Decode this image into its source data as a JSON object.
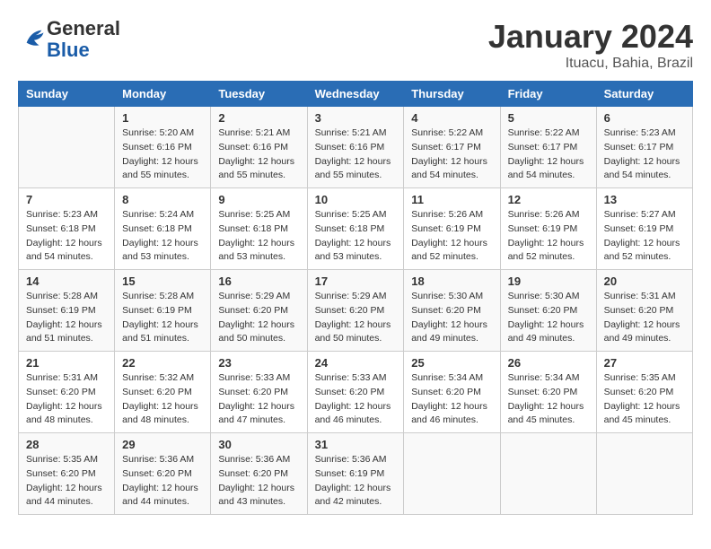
{
  "logo": {
    "general": "General",
    "blue": "Blue"
  },
  "header": {
    "month": "January 2024",
    "location": "Ituacu, Bahia, Brazil"
  },
  "columns": [
    "Sunday",
    "Monday",
    "Tuesday",
    "Wednesday",
    "Thursday",
    "Friday",
    "Saturday"
  ],
  "weeks": [
    [
      {
        "day": "",
        "sunrise": "",
        "sunset": "",
        "daylight": ""
      },
      {
        "day": "1",
        "sunrise": "Sunrise: 5:20 AM",
        "sunset": "Sunset: 6:16 PM",
        "daylight": "Daylight: 12 hours and 55 minutes."
      },
      {
        "day": "2",
        "sunrise": "Sunrise: 5:21 AM",
        "sunset": "Sunset: 6:16 PM",
        "daylight": "Daylight: 12 hours and 55 minutes."
      },
      {
        "day": "3",
        "sunrise": "Sunrise: 5:21 AM",
        "sunset": "Sunset: 6:16 PM",
        "daylight": "Daylight: 12 hours and 55 minutes."
      },
      {
        "day": "4",
        "sunrise": "Sunrise: 5:22 AM",
        "sunset": "Sunset: 6:17 PM",
        "daylight": "Daylight: 12 hours and 54 minutes."
      },
      {
        "day": "5",
        "sunrise": "Sunrise: 5:22 AM",
        "sunset": "Sunset: 6:17 PM",
        "daylight": "Daylight: 12 hours and 54 minutes."
      },
      {
        "day": "6",
        "sunrise": "Sunrise: 5:23 AM",
        "sunset": "Sunset: 6:17 PM",
        "daylight": "Daylight: 12 hours and 54 minutes."
      }
    ],
    [
      {
        "day": "7",
        "sunrise": "Sunrise: 5:23 AM",
        "sunset": "Sunset: 6:18 PM",
        "daylight": "Daylight: 12 hours and 54 minutes."
      },
      {
        "day": "8",
        "sunrise": "Sunrise: 5:24 AM",
        "sunset": "Sunset: 6:18 PM",
        "daylight": "Daylight: 12 hours and 53 minutes."
      },
      {
        "day": "9",
        "sunrise": "Sunrise: 5:25 AM",
        "sunset": "Sunset: 6:18 PM",
        "daylight": "Daylight: 12 hours and 53 minutes."
      },
      {
        "day": "10",
        "sunrise": "Sunrise: 5:25 AM",
        "sunset": "Sunset: 6:18 PM",
        "daylight": "Daylight: 12 hours and 53 minutes."
      },
      {
        "day": "11",
        "sunrise": "Sunrise: 5:26 AM",
        "sunset": "Sunset: 6:19 PM",
        "daylight": "Daylight: 12 hours and 52 minutes."
      },
      {
        "day": "12",
        "sunrise": "Sunrise: 5:26 AM",
        "sunset": "Sunset: 6:19 PM",
        "daylight": "Daylight: 12 hours and 52 minutes."
      },
      {
        "day": "13",
        "sunrise": "Sunrise: 5:27 AM",
        "sunset": "Sunset: 6:19 PM",
        "daylight": "Daylight: 12 hours and 52 minutes."
      }
    ],
    [
      {
        "day": "14",
        "sunrise": "Sunrise: 5:28 AM",
        "sunset": "Sunset: 6:19 PM",
        "daylight": "Daylight: 12 hours and 51 minutes."
      },
      {
        "day": "15",
        "sunrise": "Sunrise: 5:28 AM",
        "sunset": "Sunset: 6:19 PM",
        "daylight": "Daylight: 12 hours and 51 minutes."
      },
      {
        "day": "16",
        "sunrise": "Sunrise: 5:29 AM",
        "sunset": "Sunset: 6:20 PM",
        "daylight": "Daylight: 12 hours and 50 minutes."
      },
      {
        "day": "17",
        "sunrise": "Sunrise: 5:29 AM",
        "sunset": "Sunset: 6:20 PM",
        "daylight": "Daylight: 12 hours and 50 minutes."
      },
      {
        "day": "18",
        "sunrise": "Sunrise: 5:30 AM",
        "sunset": "Sunset: 6:20 PM",
        "daylight": "Daylight: 12 hours and 49 minutes."
      },
      {
        "day": "19",
        "sunrise": "Sunrise: 5:30 AM",
        "sunset": "Sunset: 6:20 PM",
        "daylight": "Daylight: 12 hours and 49 minutes."
      },
      {
        "day": "20",
        "sunrise": "Sunrise: 5:31 AM",
        "sunset": "Sunset: 6:20 PM",
        "daylight": "Daylight: 12 hours and 49 minutes."
      }
    ],
    [
      {
        "day": "21",
        "sunrise": "Sunrise: 5:31 AM",
        "sunset": "Sunset: 6:20 PM",
        "daylight": "Daylight: 12 hours and 48 minutes."
      },
      {
        "day": "22",
        "sunrise": "Sunrise: 5:32 AM",
        "sunset": "Sunset: 6:20 PM",
        "daylight": "Daylight: 12 hours and 48 minutes."
      },
      {
        "day": "23",
        "sunrise": "Sunrise: 5:33 AM",
        "sunset": "Sunset: 6:20 PM",
        "daylight": "Daylight: 12 hours and 47 minutes."
      },
      {
        "day": "24",
        "sunrise": "Sunrise: 5:33 AM",
        "sunset": "Sunset: 6:20 PM",
        "daylight": "Daylight: 12 hours and 46 minutes."
      },
      {
        "day": "25",
        "sunrise": "Sunrise: 5:34 AM",
        "sunset": "Sunset: 6:20 PM",
        "daylight": "Daylight: 12 hours and 46 minutes."
      },
      {
        "day": "26",
        "sunrise": "Sunrise: 5:34 AM",
        "sunset": "Sunset: 6:20 PM",
        "daylight": "Daylight: 12 hours and 45 minutes."
      },
      {
        "day": "27",
        "sunrise": "Sunrise: 5:35 AM",
        "sunset": "Sunset: 6:20 PM",
        "daylight": "Daylight: 12 hours and 45 minutes."
      }
    ],
    [
      {
        "day": "28",
        "sunrise": "Sunrise: 5:35 AM",
        "sunset": "Sunset: 6:20 PM",
        "daylight": "Daylight: 12 hours and 44 minutes."
      },
      {
        "day": "29",
        "sunrise": "Sunrise: 5:36 AM",
        "sunset": "Sunset: 6:20 PM",
        "daylight": "Daylight: 12 hours and 44 minutes."
      },
      {
        "day": "30",
        "sunrise": "Sunrise: 5:36 AM",
        "sunset": "Sunset: 6:20 PM",
        "daylight": "Daylight: 12 hours and 43 minutes."
      },
      {
        "day": "31",
        "sunrise": "Sunrise: 5:36 AM",
        "sunset": "Sunset: 6:19 PM",
        "daylight": "Daylight: 12 hours and 42 minutes."
      },
      {
        "day": "",
        "sunrise": "",
        "sunset": "",
        "daylight": ""
      },
      {
        "day": "",
        "sunrise": "",
        "sunset": "",
        "daylight": ""
      },
      {
        "day": "",
        "sunrise": "",
        "sunset": "",
        "daylight": ""
      }
    ]
  ]
}
